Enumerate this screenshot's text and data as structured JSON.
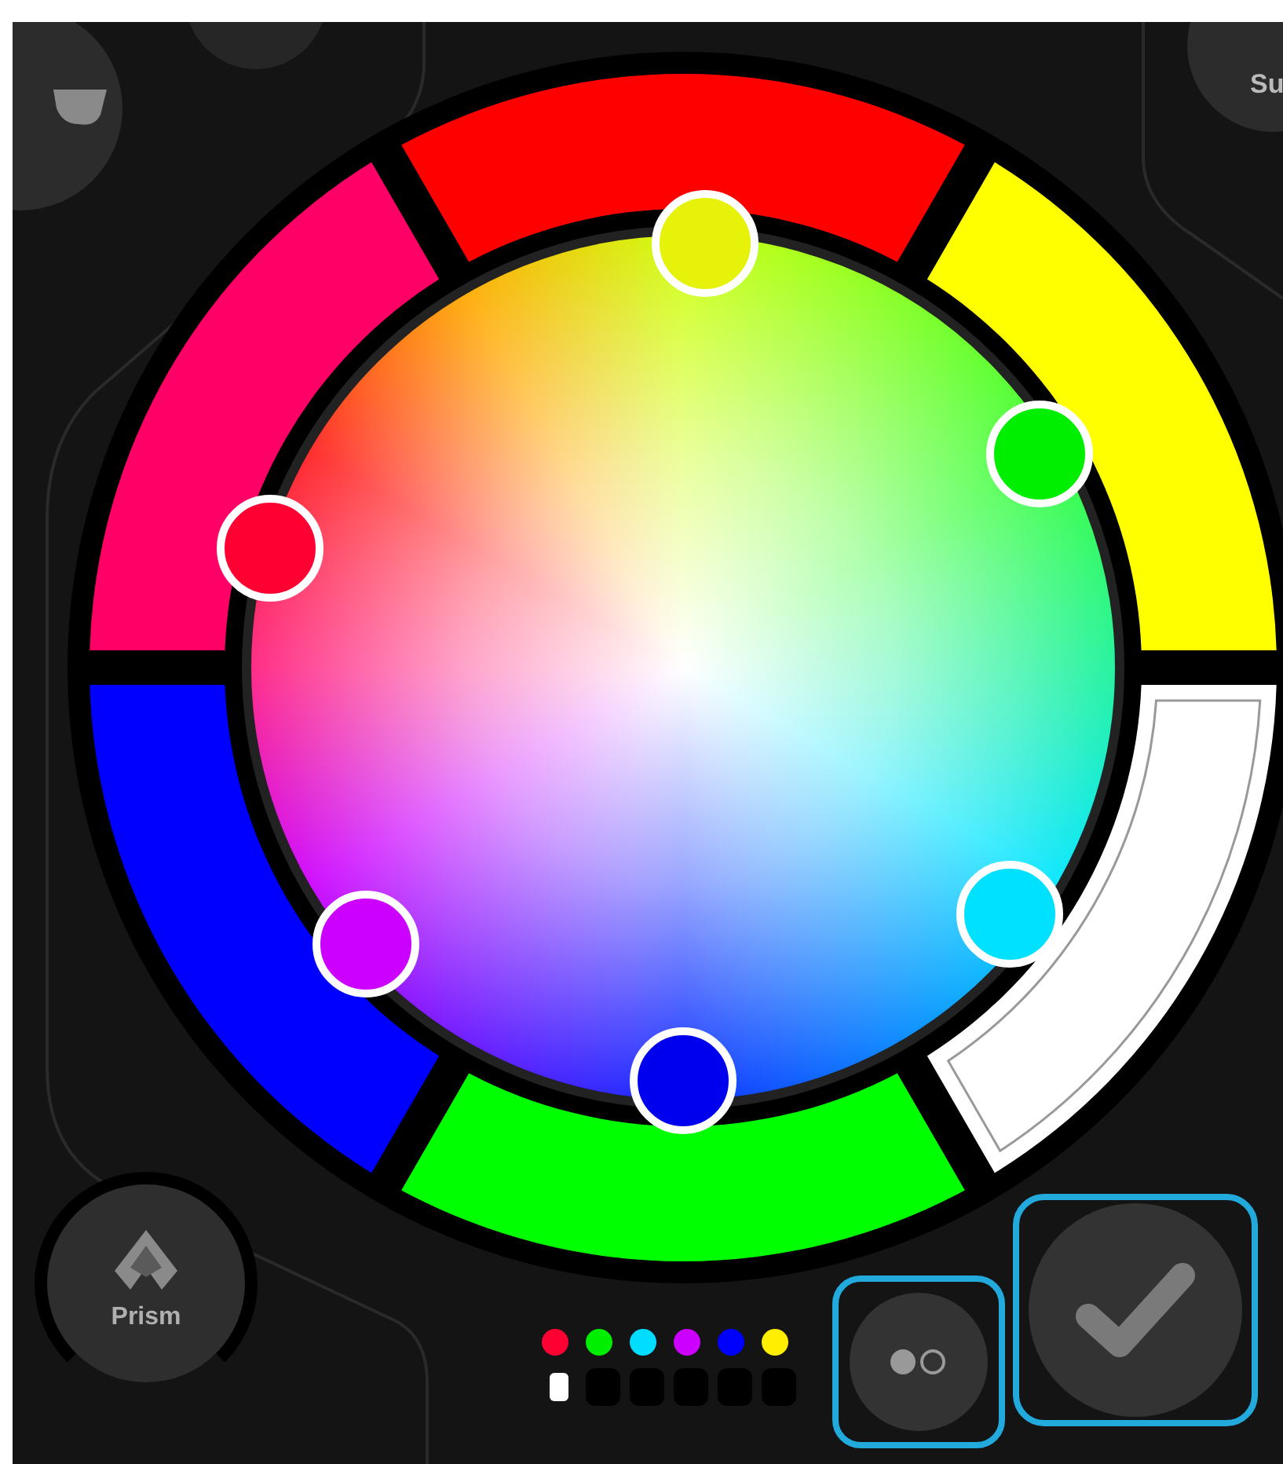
{
  "top_right_label": "Su",
  "ring_segments": [
    {
      "color": "#ff0000",
      "selected": false
    },
    {
      "color": "#ffff00",
      "selected": false
    },
    {
      "color": "#ffffff",
      "selected": true
    },
    {
      "color": "#00ff00",
      "selected": false
    },
    {
      "color": "#0000ff",
      "selected": false
    },
    {
      "color": "#ff0066",
      "selected": false
    }
  ],
  "handles": [
    {
      "color": "#e6f20a"
    },
    {
      "color": "#00ee00"
    },
    {
      "color": "#00e0ff"
    },
    {
      "color": "#0000ee"
    },
    {
      "color": "#cc00ff"
    },
    {
      "color": "#ff0033"
    }
  ],
  "prism_button": {
    "label": "Prism"
  },
  "swatches": [
    {
      "color": "#ff0033"
    },
    {
      "color": "#00ee00"
    },
    {
      "color": "#00ddff"
    },
    {
      "color": "#cc00ff"
    },
    {
      "color": "#0000ff"
    },
    {
      "color": "#ffee00"
    }
  ],
  "slots": [
    {
      "filled": true
    },
    {
      "filled": false
    },
    {
      "filled": false
    },
    {
      "filled": false
    },
    {
      "filled": false
    },
    {
      "filled": false
    }
  ],
  "mode_button": {
    "selected": true
  },
  "confirm_button": {
    "selected": true
  }
}
